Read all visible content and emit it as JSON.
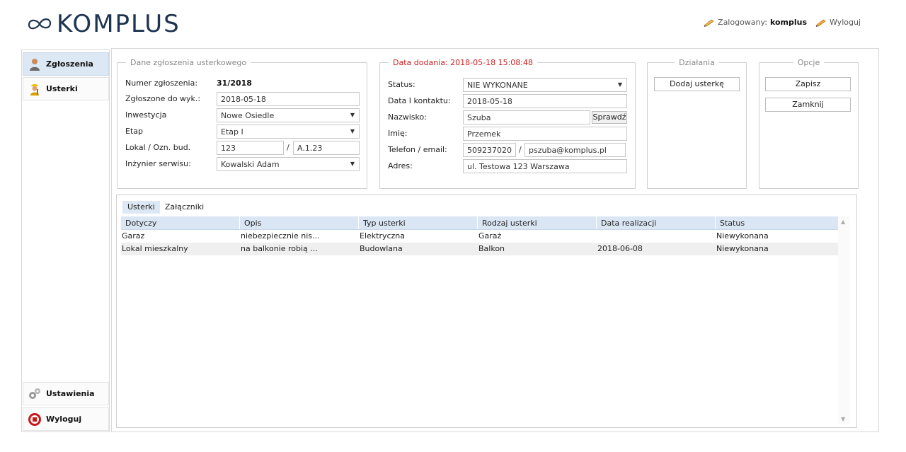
{
  "header": {
    "logo_text": "KOMPLUS",
    "logged_label": "Zalogowany:",
    "username": "komplus",
    "logout_label": "Wyloguj"
  },
  "sidebar": {
    "items": [
      {
        "label": "Zgłoszenia"
      },
      {
        "label": "Usterki"
      },
      {
        "label": "Ustawienia"
      },
      {
        "label": "Wyloguj"
      }
    ]
  },
  "report": {
    "legend": "Dane zgłoszenia usterkowego",
    "number_label": "Numer zgłoszenia:",
    "number_value": "31/2018",
    "submitted_label": "Zgłoszone do wyk.:",
    "submitted_value": "2018-05-18",
    "investment_label": "Inwestycja",
    "investment_value": "Nowe Osiedle",
    "stage_label": "Etap",
    "stage_value": "Etap I",
    "unit_label": "Lokal / Ozn. bud.",
    "unit_value": "123",
    "building_value": "A.1.23",
    "engineer_label": "Inżynier serwisu:",
    "engineer_value": "Kowalski Adam"
  },
  "contact": {
    "legend": "Data dodania: 2018-05-18 15:08:48",
    "status_label": "Status:",
    "status_value": "NIE WYKONANE",
    "contact_date_label": "Data I kontaktu:",
    "contact_date_value": "2018-05-18",
    "surname_label": "Nazwisko:",
    "surname_value": "Szuba",
    "check_button": "Sprawdź",
    "name_label": "Imię:",
    "name_value": "Przemek",
    "phone_label": "Telefon / email:",
    "phone_value": "509237020",
    "email_value": "pszuba@komplus.pl",
    "address_label": "Adres:",
    "address_value": "ul. Testowa 123 Warszawa"
  },
  "actions": {
    "legend": "Działania",
    "add_defect": "Dodaj usterkę"
  },
  "options": {
    "legend": "Opcje",
    "save": "Zapisz",
    "close": "Zamknij"
  },
  "tabs": [
    {
      "label": "Usterki"
    },
    {
      "label": "Załączniki"
    }
  ],
  "grid": {
    "columns": [
      "Dotyczy",
      "Opis",
      "Typ usterki",
      "Rodzaj usterki",
      "Data realizacji",
      "Status"
    ],
    "rows": [
      [
        "Garaz",
        "niebezpiecznie nis...",
        "Elektryczna",
        "Garaż",
        "",
        "Niewykonana"
      ],
      [
        "Lokal mieszkalny",
        "na balkonie robią ...",
        "Budowlana",
        "Balkon",
        "2018-06-08",
        "Niewykonana"
      ]
    ]
  }
}
